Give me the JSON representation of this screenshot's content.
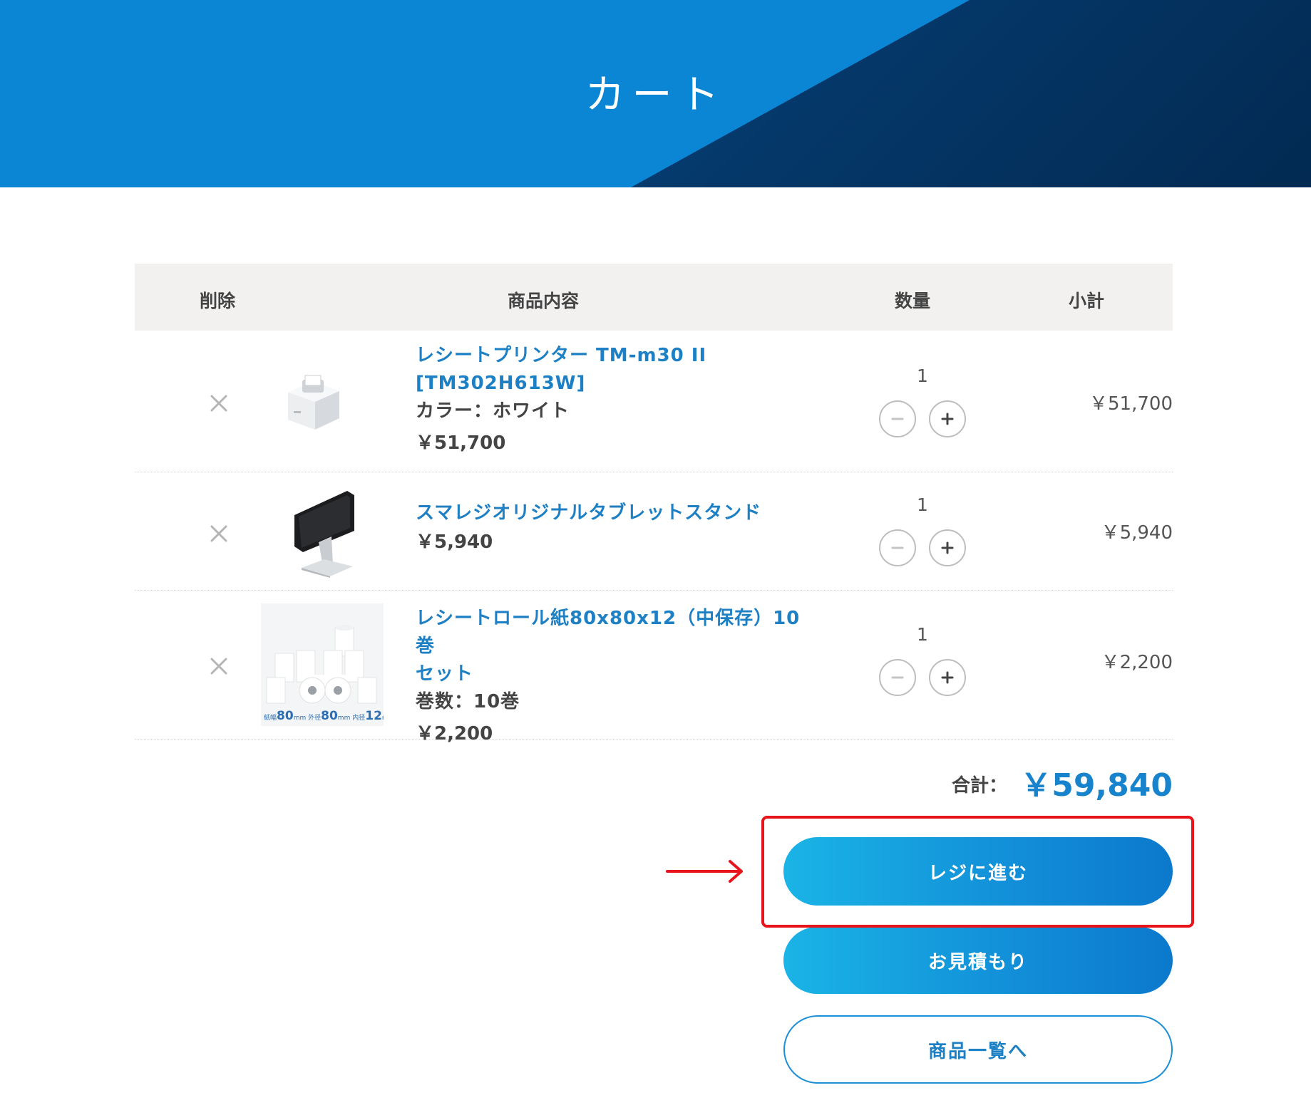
{
  "page": {
    "title": "カート"
  },
  "table": {
    "headers": {
      "delete": "削除",
      "product": "商品内容",
      "quantity": "数量",
      "subtotal": "小計"
    }
  },
  "items": [
    {
      "name_line1": "レシートプリンター TM-m30 II",
      "name_line2": "[TM302H613W]",
      "attribute": "カラー：ホワイト",
      "price": "￥51,700",
      "quantity": "1",
      "subtotal": "￥51,700",
      "image": "receipt-printer-image"
    },
    {
      "name_line1": "スマレジオリジナルタブレットスタンド",
      "price": "￥5,940",
      "quantity": "1",
      "subtotal": "￥5,940",
      "image": "tablet-stand-image"
    },
    {
      "name_line1": "レシートロール紙80x80x12（中保存）10巻",
      "name_line2": "セット",
      "attribute": "巻数：10巻",
      "price": "￥2,200",
      "quantity": "1",
      "subtotal": "￥2,200",
      "image": "receipt-roll-image",
      "image_caption": {
        "width_label": "紙幅",
        "width_value": "80",
        "outer_label": "外径",
        "outer_value": "80",
        "inner_label": "内径",
        "inner_value": "12",
        "unit": "mm"
      }
    }
  ],
  "total": {
    "label": "合計：",
    "value": "￥59,840"
  },
  "buttons": {
    "checkout": "レジに進む",
    "quote": "お見積もり",
    "product_list": "商品一覧へ"
  },
  "icons": {
    "delete": "close-icon",
    "decrement": "minus-icon",
    "increment": "plus-icon",
    "annotation_arrow": "arrow-right-icon"
  },
  "colors": {
    "brand_blue": "#1683cc",
    "link_blue": "#1d7fc4",
    "annotation_red": "#e8141b",
    "header_bg": "#f2f1f0"
  }
}
